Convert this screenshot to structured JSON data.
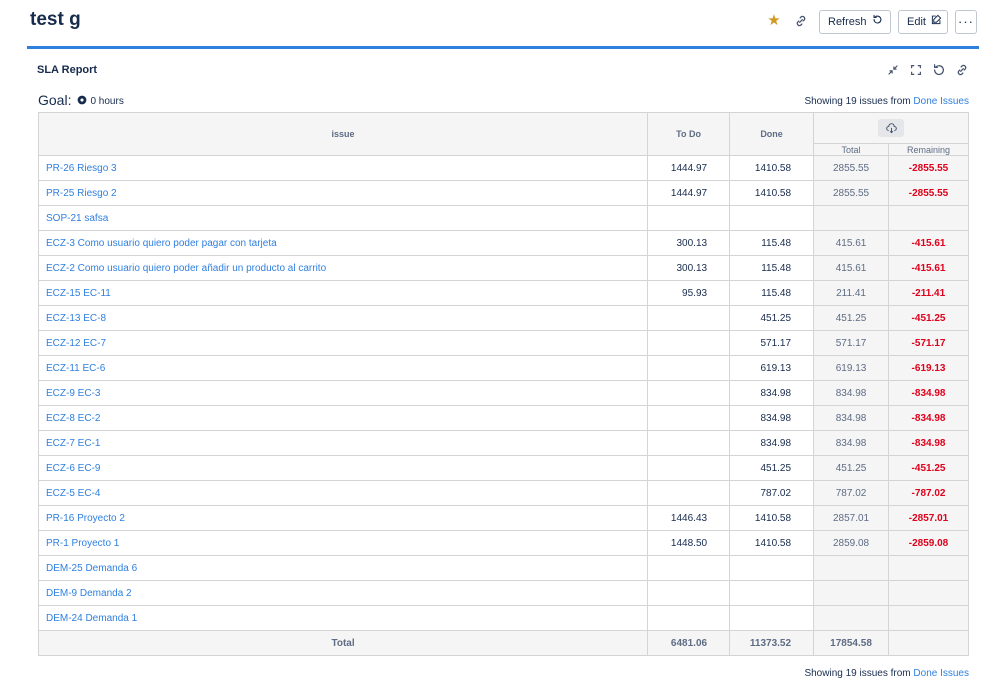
{
  "header": {
    "title": "test g",
    "refresh_label": "Refresh",
    "edit_label": "Edit",
    "more_label": "···",
    "accent_color": "#2f7fe0",
    "star_color": "#d29920"
  },
  "gadget": {
    "title": "SLA Report",
    "goal_label": "Goal:",
    "goal_value": "0 hours",
    "showing_prefix": "Showing 19 issues from",
    "showing_link": "Done Issues"
  },
  "table": {
    "headers": {
      "issue": "issue",
      "todo": "To Do",
      "done": "Done",
      "total": "Total",
      "remaining": "Remaining"
    },
    "rows": [
      {
        "issue": "PR-26 Riesgo 3",
        "todo": "1444.97",
        "done": "1410.58",
        "total": "2855.55",
        "remaining": "-2855.55"
      },
      {
        "issue": "PR-25 Riesgo 2",
        "todo": "1444.97",
        "done": "1410.58",
        "total": "2855.55",
        "remaining": "-2855.55"
      },
      {
        "issue": "SOP-21 safsa",
        "todo": "",
        "done": "",
        "total": "",
        "remaining": ""
      },
      {
        "issue": "ECZ-3 Como usuario quiero poder pagar con tarjeta",
        "todo": "300.13",
        "done": "115.48",
        "total": "415.61",
        "remaining": "-415.61"
      },
      {
        "issue": "ECZ-2 Como usuario quiero poder añadir un producto al carrito",
        "todo": "300.13",
        "done": "115.48",
        "total": "415.61",
        "remaining": "-415.61"
      },
      {
        "issue": "ECZ-15 EC-11",
        "todo": "95.93",
        "done": "115.48",
        "total": "211.41",
        "remaining": "-211.41"
      },
      {
        "issue": "ECZ-13 EC-8",
        "todo": "",
        "done": "451.25",
        "total": "451.25",
        "remaining": "-451.25"
      },
      {
        "issue": "ECZ-12 EC-7",
        "todo": "",
        "done": "571.17",
        "total": "571.17",
        "remaining": "-571.17"
      },
      {
        "issue": "ECZ-11 EC-6",
        "todo": "",
        "done": "619.13",
        "total": "619.13",
        "remaining": "-619.13"
      },
      {
        "issue": "ECZ-9 EC-3",
        "todo": "",
        "done": "834.98",
        "total": "834.98",
        "remaining": "-834.98"
      },
      {
        "issue": "ECZ-8 EC-2",
        "todo": "",
        "done": "834.98",
        "total": "834.98",
        "remaining": "-834.98"
      },
      {
        "issue": "ECZ-7 EC-1",
        "todo": "",
        "done": "834.98",
        "total": "834.98",
        "remaining": "-834.98"
      },
      {
        "issue": "ECZ-6 EC-9",
        "todo": "",
        "done": "451.25",
        "total": "451.25",
        "remaining": "-451.25"
      },
      {
        "issue": "ECZ-5 EC-4",
        "todo": "",
        "done": "787.02",
        "total": "787.02",
        "remaining": "-787.02"
      },
      {
        "issue": "PR-16 Proyecto 2",
        "todo": "1446.43",
        "done": "1410.58",
        "total": "2857.01",
        "remaining": "-2857.01"
      },
      {
        "issue": "PR-1 Proyecto 1",
        "todo": "1448.50",
        "done": "1410.58",
        "total": "2859.08",
        "remaining": "-2859.08"
      },
      {
        "issue": "DEM-25 Demanda 6",
        "todo": "",
        "done": "",
        "total": "",
        "remaining": ""
      },
      {
        "issue": "DEM-9 Demanda 2",
        "todo": "",
        "done": "",
        "total": "",
        "remaining": ""
      },
      {
        "issue": "DEM-24 Demanda 1",
        "todo": "",
        "done": "",
        "total": "",
        "remaining": ""
      }
    ],
    "footer": {
      "label": "Total",
      "todo": "6481.06",
      "done": "11373.52",
      "total": "17854.58",
      "remaining": ""
    }
  }
}
